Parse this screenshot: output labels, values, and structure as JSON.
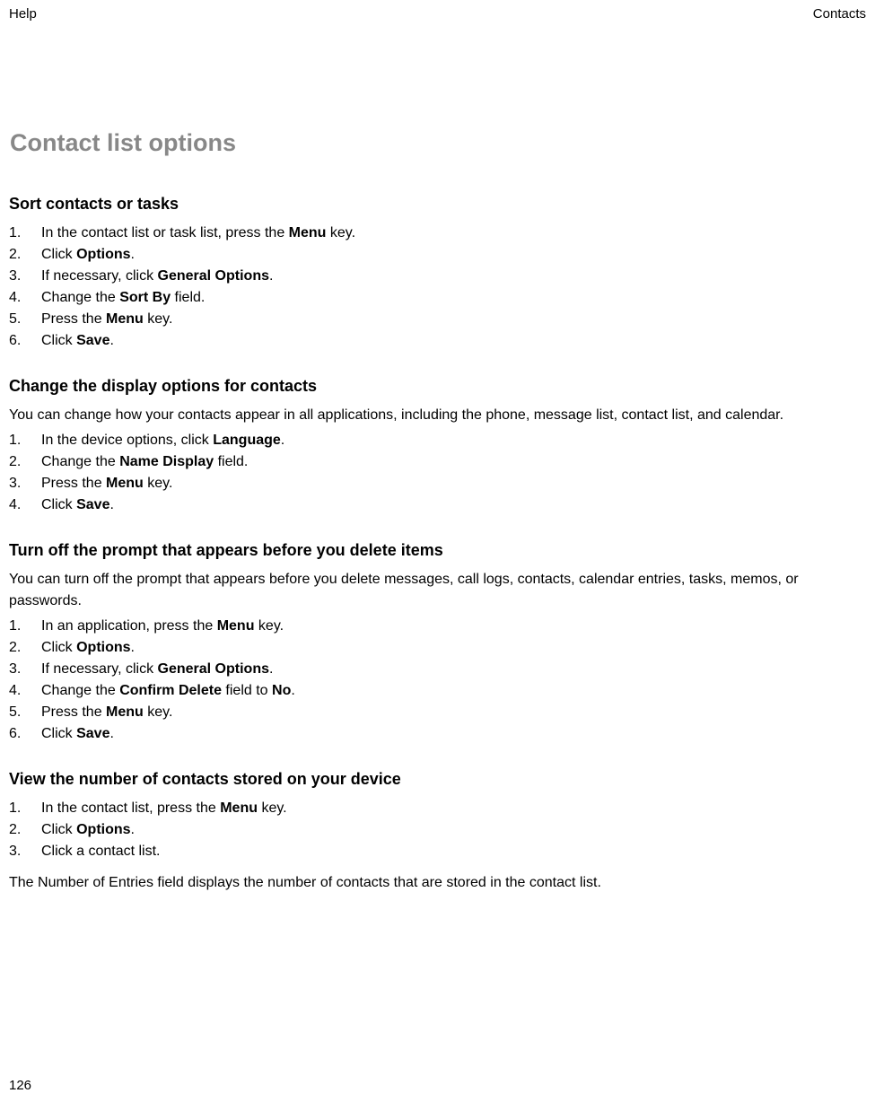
{
  "header": {
    "left": "Help",
    "right": "Contacts"
  },
  "pageTitle": "Contact list options",
  "sections": [
    {
      "heading": "Sort contacts or tasks",
      "intro": "",
      "steps": [
        {
          "pre": "In the contact list or task list, press the ",
          "bold": "Menu",
          "post": " key."
        },
        {
          "pre": "Click ",
          "bold": "Options",
          "post": "."
        },
        {
          "pre": "If necessary, click ",
          "bold": "General Options",
          "post": "."
        },
        {
          "pre": "Change the ",
          "bold": "Sort By",
          "post": " field."
        },
        {
          "pre": "Press the ",
          "bold": "Menu",
          "post": " key."
        },
        {
          "pre": "Click ",
          "bold": "Save",
          "post": "."
        }
      ],
      "footer": ""
    },
    {
      "heading": "Change the display options for contacts",
      "intro": "You can change how your contacts appear in all applications, including the phone, message list, contact list, and calendar.",
      "steps": [
        {
          "pre": "In the device options, click ",
          "bold": "Language",
          "post": "."
        },
        {
          "pre": "Change the ",
          "bold": "Name Display",
          "post": " field."
        },
        {
          "pre": "Press the ",
          "bold": "Menu",
          "post": " key."
        },
        {
          "pre": "Click ",
          "bold": "Save",
          "post": "."
        }
      ],
      "footer": ""
    },
    {
      "heading": "Turn off the prompt that appears before you delete items",
      "intro": "You can turn off the prompt that appears before you delete messages, call logs, contacts, calendar entries, tasks, memos, or passwords.",
      "steps": [
        {
          "pre": "In an application, press the ",
          "bold": "Menu",
          "post": " key."
        },
        {
          "pre": "Click ",
          "bold": "Options",
          "post": "."
        },
        {
          "pre": "If necessary, click ",
          "bold": "General Options",
          "post": "."
        },
        {
          "pre": "Change the ",
          "bold": "Confirm Delete",
          "post": " field to ",
          "bold2": "No",
          "post2": "."
        },
        {
          "pre": "Press the ",
          "bold": "Menu",
          "post": " key."
        },
        {
          "pre": "Click ",
          "bold": "Save",
          "post": "."
        }
      ],
      "footer": ""
    },
    {
      "heading": "View the number of contacts stored on your device",
      "intro": "",
      "steps": [
        {
          "pre": "In the contact list, press the ",
          "bold": "Menu",
          "post": " key."
        },
        {
          "pre": "Click ",
          "bold": "Options",
          "post": "."
        },
        {
          "pre": "Click a contact list.",
          "bold": "",
          "post": ""
        }
      ],
      "footer": "The Number of Entries field displays the number of contacts that are stored in the contact list."
    }
  ],
  "pageNumber": "126"
}
